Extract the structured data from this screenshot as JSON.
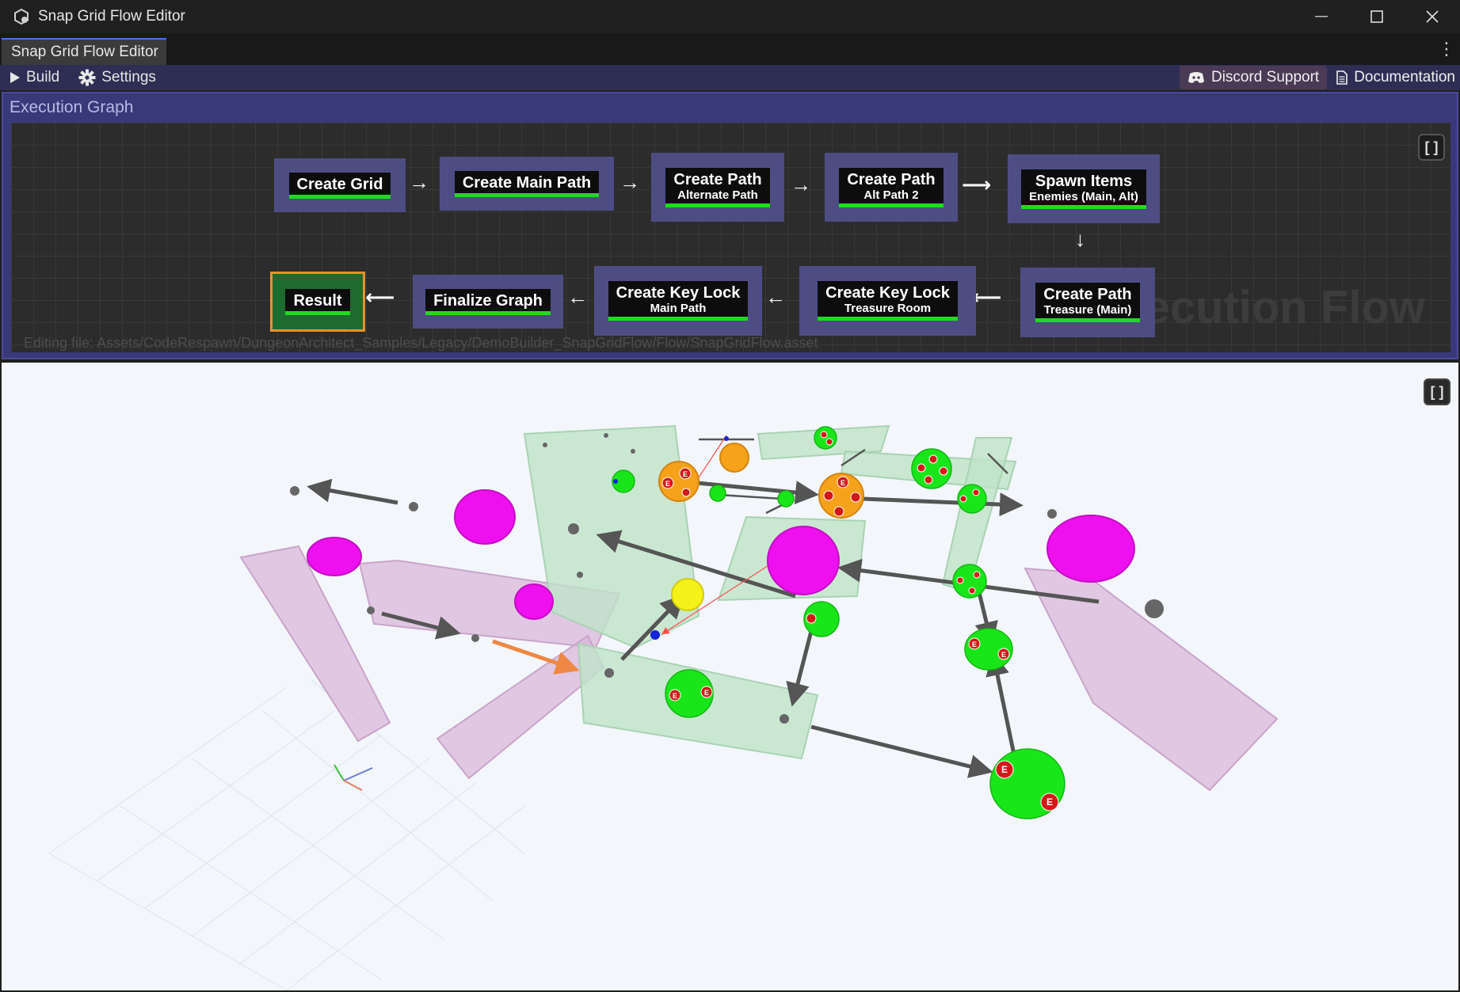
{
  "window": {
    "title": "Snap Grid Flow Editor",
    "icon": "unity-cube-icon",
    "controls": [
      "minimize-icon",
      "maximize-icon",
      "close-icon"
    ]
  },
  "tab": {
    "label": "Snap Grid Flow Editor"
  },
  "toolbar": {
    "build_label": "Build",
    "settings_label": "Settings",
    "discord_label": "Discord Support",
    "docs_label": "Documentation"
  },
  "execution_graph": {
    "header": "Execution Graph",
    "watermark": "Execution Flow",
    "editing_file": "Editing file: Assets/CodeRespawn/DungeonArchitect_Samples/Legacy/DemoBuilder_SnapGridFlow/Flow/SnapGridFlow.asset",
    "nodes": [
      {
        "title": "Create Grid",
        "subtitle": ""
      },
      {
        "title": "Create Main Path",
        "subtitle": ""
      },
      {
        "title": "Create Path",
        "subtitle": "Alternate Path"
      },
      {
        "title": "Create Path",
        "subtitle": "Alt Path 2"
      },
      {
        "title": "Spawn Items",
        "subtitle": "Enemies (Main, Alt)"
      },
      {
        "title": "Create Path",
        "subtitle": "Treasure (Main)"
      },
      {
        "title": "Create Key Lock",
        "subtitle": "Treasure Room"
      },
      {
        "title": "Create Key Lock",
        "subtitle": "Main Path"
      },
      {
        "title": "Finalize Graph",
        "subtitle": ""
      },
      {
        "title": "Result",
        "subtitle": ""
      }
    ]
  },
  "viewport": {
    "enemy_marker_label": "E",
    "colors": {
      "room_green": "#bfe3c8",
      "room_purple": "#d9b7d9",
      "node_green": "#19e619",
      "node_magenta": "#ee10ee",
      "node_orange": "#f7a21b",
      "node_yellow": "#f5f21a",
      "enemy_red": "#d31818",
      "link_gray": "#555555",
      "link_orange": "#ee8844",
      "link_red": "#ff4d4d"
    }
  }
}
